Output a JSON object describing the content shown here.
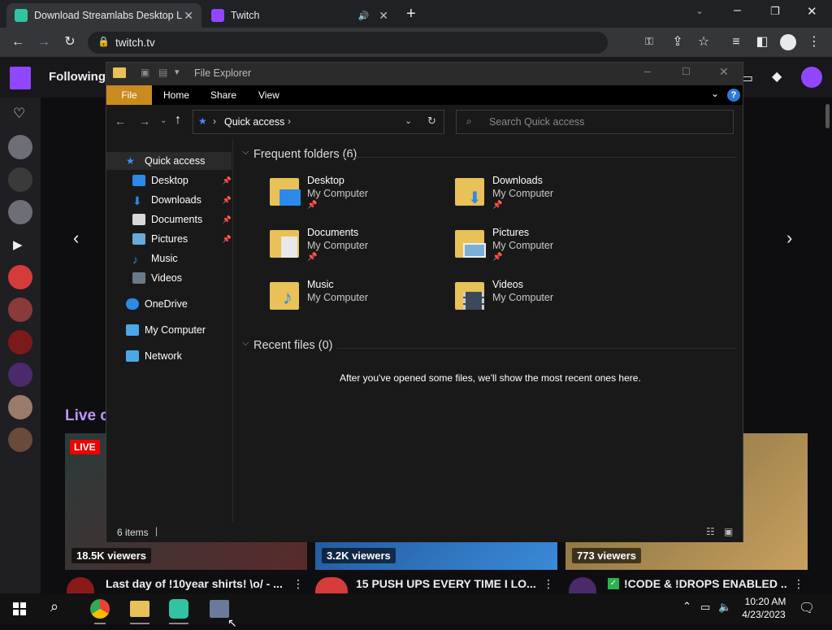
{
  "browser": {
    "tabs": [
      {
        "title": "Download Streamlabs Desktop L"
      },
      {
        "title": "Twitch"
      }
    ],
    "url": "twitch.tv"
  },
  "twitch": {
    "following_label": "Following",
    "live_section_label": "Live cl",
    "live_badge": "LIVE",
    "cards": [
      {
        "viewers": "18.5K viewers",
        "title": "Last day of !10year shirts! \\o/ - ..."
      },
      {
        "viewers": "3.2K viewers",
        "title": "15 PUSH UPS EVERY TIME I LO..."
      },
      {
        "viewers": "773 viewers",
        "title": "!CODE & !DROPS ENABLED ..."
      }
    ],
    "colors": {
      "accent": "#9146ff",
      "live": "#eb0400"
    }
  },
  "explorer": {
    "title": "File Explorer",
    "ribbon": [
      "File",
      "Home",
      "Share",
      "View"
    ],
    "breadcrumb": "Quick access",
    "search_placeholder": "Search Quick access",
    "nav": [
      {
        "label": "Quick access",
        "icon": "star-icon"
      },
      {
        "label": "Desktop",
        "icon": "desktop-icon",
        "pinned": true
      },
      {
        "label": "Downloads",
        "icon": "download-icon",
        "pinned": true
      },
      {
        "label": "Documents",
        "icon": "document-icon",
        "pinned": true
      },
      {
        "label": "Pictures",
        "icon": "picture-icon",
        "pinned": true
      },
      {
        "label": "Music",
        "icon": "music-icon"
      },
      {
        "label": "Videos",
        "icon": "video-icon"
      },
      {
        "label": "OneDrive",
        "icon": "cloud-icon"
      },
      {
        "label": "My Computer",
        "icon": "computer-icon"
      },
      {
        "label": "Network",
        "icon": "network-icon"
      }
    ],
    "frequent_header": "Frequent folders (6)",
    "folders": [
      {
        "name": "Desktop",
        "location": "My Computer",
        "pinned": true
      },
      {
        "name": "Downloads",
        "location": "My Computer",
        "pinned": true
      },
      {
        "name": "Documents",
        "location": "My Computer",
        "pinned": true
      },
      {
        "name": "Pictures",
        "location": "My Computer",
        "pinned": true
      },
      {
        "name": "Music",
        "location": "My Computer",
        "pinned": false
      },
      {
        "name": "Videos",
        "location": "My Computer",
        "pinned": false
      }
    ],
    "recent_header": "Recent files (0)",
    "recent_empty": "After you've opened some files, we'll show the most recent ones here.",
    "status": "6 items"
  },
  "taskbar": {
    "time": "10:20 AM",
    "date": "4/23/2023"
  }
}
